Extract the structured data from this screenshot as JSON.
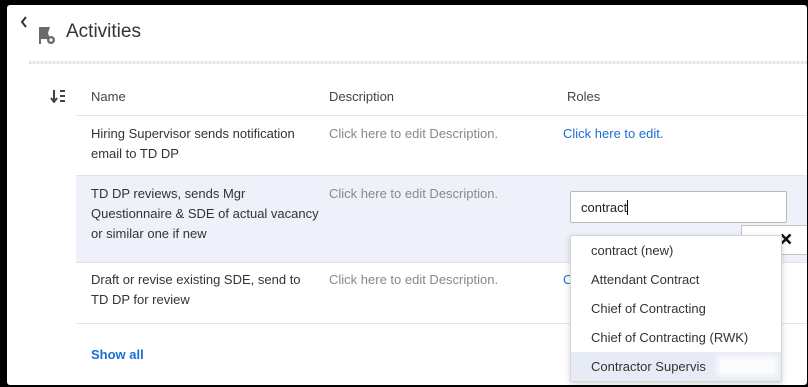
{
  "header": {
    "title": "Activities",
    "back_icon": "chevron-left-icon",
    "activity_icon": "activity-settings-icon"
  },
  "table": {
    "sort_icon": "sort-order-icon",
    "columns": {
      "name": "Name",
      "description": "Description",
      "roles": "Roles"
    },
    "rows": [
      {
        "name": "Hiring Supervisor sends notification email to TD DP",
        "description": "Click here to edit Description.",
        "roles": "Click here to edit."
      },
      {
        "name": "TD DP reviews, sends Mgr Questionnaire & SDE of actual vacancy or similar one if new",
        "description": "Click here to edit Description.",
        "roles_input_value": "contract"
      },
      {
        "name": "Draft or revise existing SDE, send to TD DP for review",
        "description": "Click here to edit Description.",
        "roles": "C"
      }
    ],
    "show_all": "Show all"
  },
  "role_editor": {
    "confirm_icon": "chevron-up-icon",
    "cancel_icon": "close-icon",
    "suggestions": [
      "contract (new)",
      "Attendant Contract",
      "Chief of Contracting",
      "Chief of Contracting (RWK)",
      "Contractor Supervis"
    ],
    "highlighted_index": 4
  },
  "colors": {
    "link": "#1a6fd1",
    "row_highlight": "#eef1f9",
    "suggestion_highlight": "#e7ebf6"
  }
}
